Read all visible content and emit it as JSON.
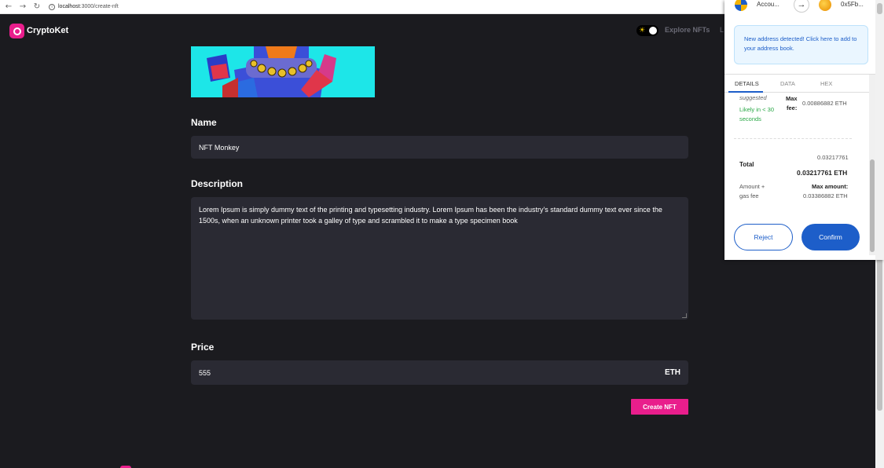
{
  "browser": {
    "url_host": "localhost",
    "url_path": ":3000/create-nft"
  },
  "app": {
    "brand": "CryptoKet",
    "nav_explore": "Explore NFTs",
    "nav_fragment": "L"
  },
  "form": {
    "name_label": "Name",
    "name_value": "NFT Monkey",
    "description_label": "Description",
    "description_value": "Lorem Ipsum is simply dummy text of the printing and typesetting industry. Lorem Ipsum has been the industry's standard dummy text ever since the 1500s, when an unknown printer took a galley of type and scrambled it to make a type specimen book",
    "price_label": "Price",
    "price_value": "555",
    "price_unit": "ETH",
    "create_button": "Create NFT"
  },
  "metamask": {
    "from_account": "Accou...",
    "to_account": "0x5Fb...",
    "notice": "New address detected! Click here to add to your address book.",
    "tabs": [
      "DETAILS",
      "DATA",
      "HEX"
    ],
    "active_tab": "DETAILS",
    "suggested_label": "suggested",
    "likely_text_1": "Likely in < 30",
    "likely_text_2": "seconds",
    "max_fee_label_1": "Max",
    "max_fee_label_2": "fee:",
    "max_fee_value": "0.00886882 ETH",
    "total_label": "Total",
    "total_value_small": "0.03217761",
    "total_value_bold": "0.03217761 ETH",
    "amount_gas_1": "Amount +",
    "amount_gas_2": "gas fee",
    "max_amount_label": "Max amount:",
    "max_amount_value": "0.03386882 ETH",
    "reject_button": "Reject",
    "confirm_button": "Confirm"
  },
  "colors": {
    "accent": "#e91e8c",
    "background": "#1b1b1f",
    "input_bg": "#2a2a33",
    "metamask_blue": "#1d5ec9"
  }
}
